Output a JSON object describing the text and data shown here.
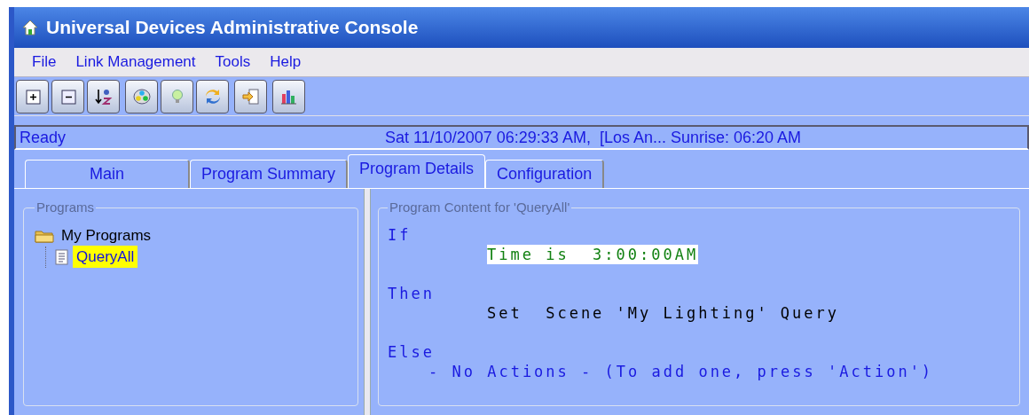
{
  "window": {
    "title": "Universal Devices Administrative Console"
  },
  "menu": [
    "File",
    "Link Management",
    "Tools",
    "Help"
  ],
  "status_bar": {
    "state": "Ready",
    "info": "Sat 11/10/2007 06:29:33 AM,  [Los An... Sunrise: 06:20 AM"
  },
  "tabs": [
    {
      "label": "Main",
      "selected": false
    },
    {
      "label": "Program Summary",
      "selected": false
    },
    {
      "label": "Program Details",
      "selected": true
    },
    {
      "label": "Configuration",
      "selected": false
    }
  ],
  "programs": {
    "title": "Programs",
    "tree": [
      {
        "label": "My Programs",
        "kind": "folder",
        "selected": false,
        "children": [
          {
            "label": "QueryAll",
            "kind": "program",
            "selected": true
          }
        ]
      }
    ]
  },
  "content": {
    "title": "Program Content for 'QueryAll'",
    "lines": [
      {
        "kind": "keyword",
        "text": "If"
      },
      {
        "kind": "condition",
        "text": "Time is  3:00:00AM"
      },
      {
        "kind": "blank"
      },
      {
        "kind": "keyword",
        "text": "Then"
      },
      {
        "kind": "action",
        "text": "Set  Scene 'My Lighting' Query"
      },
      {
        "kind": "blank"
      },
      {
        "kind": "keyword",
        "text": "Else"
      },
      {
        "kind": "note",
        "text": "- No Actions - (To add one, press 'Action')"
      }
    ]
  }
}
